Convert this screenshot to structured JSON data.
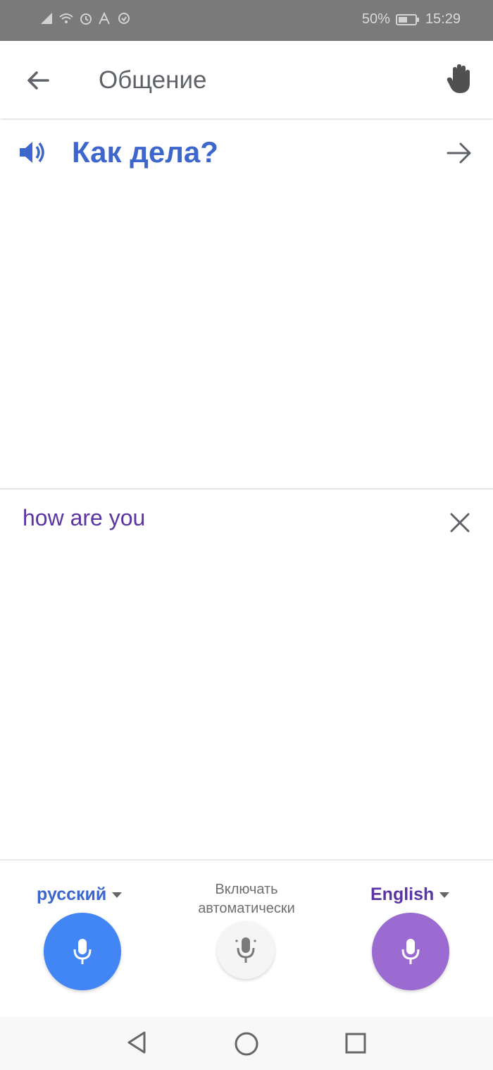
{
  "status_bar": {
    "battery": "50%",
    "time": "15:29",
    "icons": [
      "signal-icon",
      "wifi-icon",
      "alarm-icon",
      "network-icon",
      "sync-icon",
      "battery-icon"
    ]
  },
  "app_bar": {
    "title": "Общение",
    "back_icon": "back-arrow-icon",
    "hand_icon": "hand-icon"
  },
  "source_panel": {
    "text": "Как дела?",
    "speaker_icon": "speaker-icon",
    "forward_icon": "forward-arrow-icon"
  },
  "target_panel": {
    "text": "how are you",
    "close_icon": "close-icon"
  },
  "controls": {
    "left_language": "русский",
    "right_language": "English",
    "auto_label": "Включать автоматически",
    "left_mic_icon": "mic-icon",
    "center_mic_icon": "mic-icon",
    "right_mic_icon": "mic-icon"
  },
  "nav_bar": {
    "back_icon": "nav-back-icon",
    "home_icon": "nav-home-icon",
    "recent_icon": "nav-recent-icon"
  },
  "colors": {
    "status_bar": "#7a7a7a",
    "source_text": "#3d67cc",
    "target_text": "#5b35a3",
    "mic_left": "#4285f4",
    "mic_right": "#9b6bd1"
  }
}
